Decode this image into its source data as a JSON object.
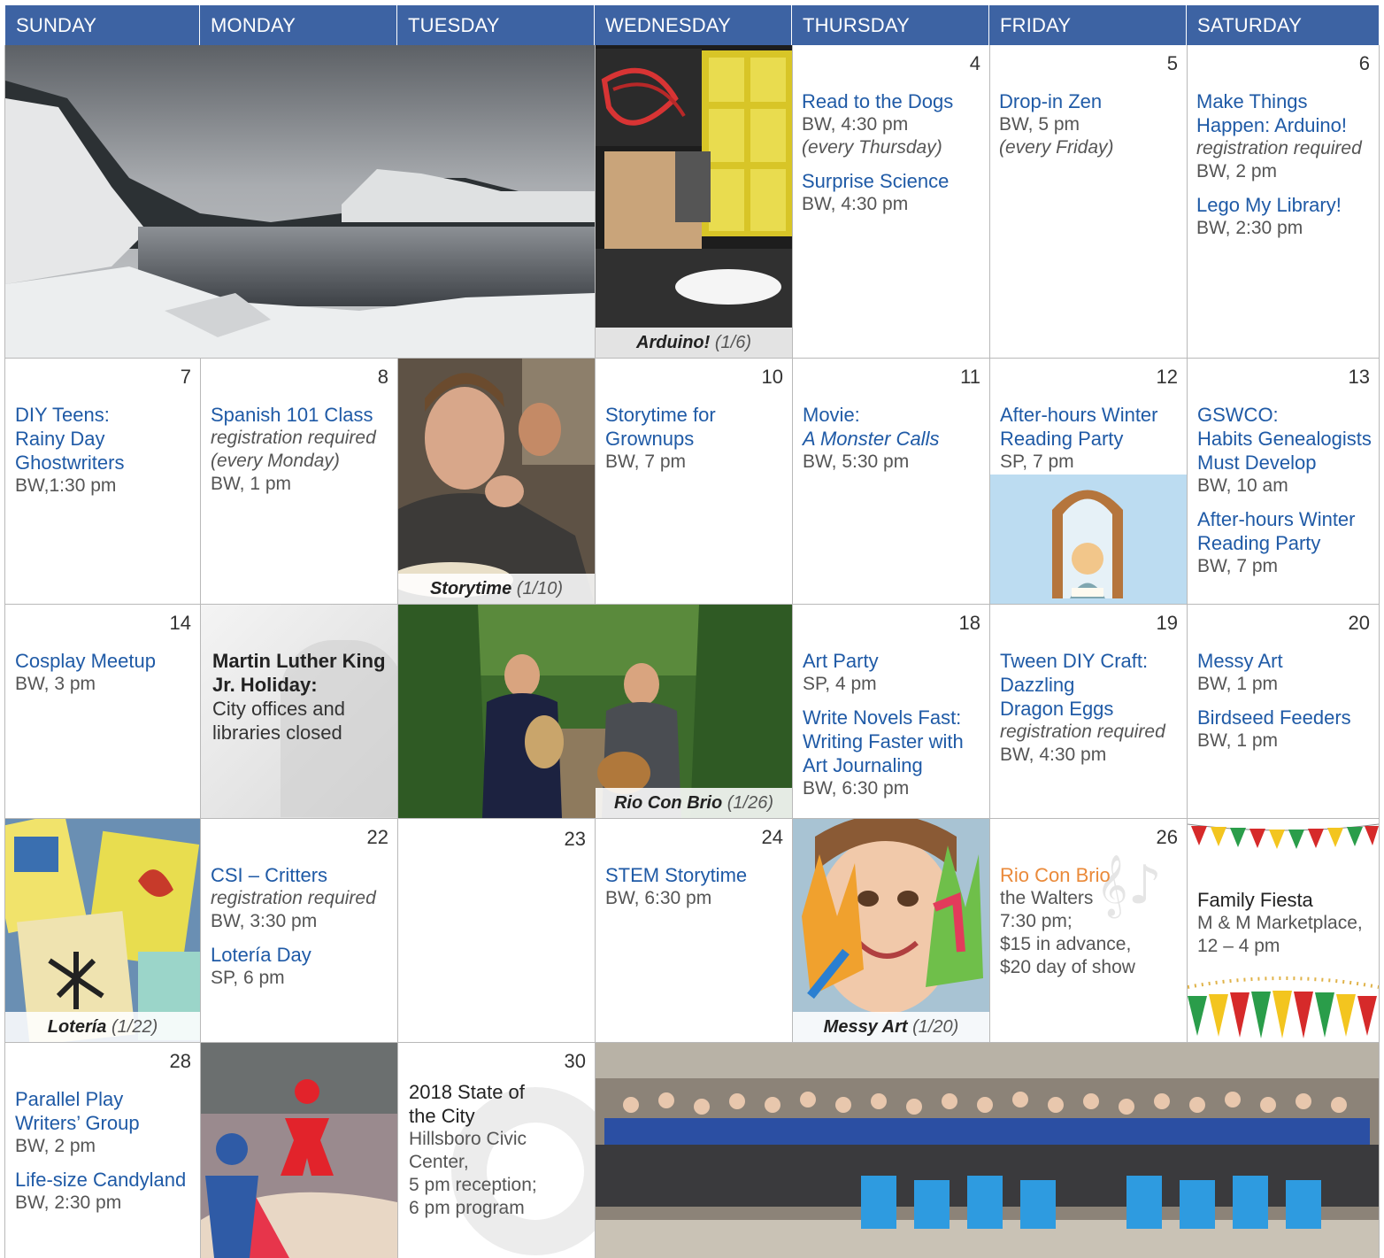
{
  "days": [
    "SUNDAY",
    "MONDAY",
    "TUESDAY",
    "WEDNESDAY",
    "THURSDAY",
    "FRIDAY",
    "SATURDAY"
  ],
  "week1": {
    "wed_caption_bold": "Arduino!",
    "wed_caption_date": "(1/6)",
    "thu": {
      "num": "4",
      "ev": [
        {
          "t": "Read to the Dogs",
          "d": "BW, 4:30 pm",
          "n": "(every Thursday)"
        },
        {
          "t": "Surprise Science",
          "d": "BW, 4:30 pm"
        }
      ]
    },
    "fri": {
      "num": "5",
      "ev": [
        {
          "t": "Drop-in Zen",
          "d": "BW, 5 pm",
          "n": "(every Friday)"
        }
      ]
    },
    "sat": {
      "num": "6",
      "ev": [
        {
          "t1": "Make Things",
          "t2": "Happen: Arduino!",
          "n": "registration required",
          "d": "BW, 2 pm"
        },
        {
          "t": "Lego My Library!",
          "d": "BW, 2:30 pm"
        }
      ]
    }
  },
  "week2": {
    "sun": {
      "num": "7",
      "t1": "DIY Teens:",
      "t2": "Rainy Day",
      "t3": "Ghostwriters",
      "d": "BW,1:30 pm"
    },
    "mon": {
      "num": "8",
      "t": "Spanish 101 Class",
      "n1": "registration required",
      "n2": "(every Monday)",
      "d": "BW, 1 pm"
    },
    "tue_caption_bold": "Storytime",
    "tue_caption_date": "(1/10)",
    "wed": {
      "num": "10",
      "t1": "Storytime for",
      "t2": "Grownups",
      "d": "BW, 7 pm"
    },
    "thu": {
      "num": "11",
      "t1": "Movie:",
      "t2": "A Monster Calls",
      "d": "BW, 5:30 pm"
    },
    "fri": {
      "num": "12",
      "t1": "After-hours Winter",
      "t2": "Reading Party",
      "d": "SP, 7 pm"
    },
    "sat": {
      "num": "13",
      "t1": "GSWCO:",
      "t2": "Habits Genealogists",
      "t3": "Must Develop",
      "d": "BW, 10 am",
      "e2t1": "After-hours Winter",
      "e2t2": "Reading Party",
      "e2d": "BW, 7 pm"
    }
  },
  "week3": {
    "sun": {
      "num": "14",
      "t": "Cosplay Meetup",
      "d": "BW, 3 pm"
    },
    "mon": {
      "t1": "Martin Luther King",
      "t2": "Jr. Holiday:",
      "d1": "City offices and",
      "d2": "libraries closed"
    },
    "tue_caption_bold": "Rio Con Brio",
    "tue_caption_date": "(1/26)",
    "thu": {
      "num": "18",
      "t": "Art Party",
      "d": "SP, 4 pm",
      "e2t1": "Write Novels Fast:",
      "e2t2": "Writing Faster with",
      "e2t3": "Art Journaling",
      "e2d": "BW, 6:30 pm"
    },
    "fri": {
      "num": "19",
      "t1": "Tween DIY Craft:",
      "t2": "Dazzling",
      "t3": "Dragon Eggs",
      "n": "registration required",
      "d": "BW, 4:30 pm"
    },
    "sat": {
      "num": "20",
      "t": "Messy Art",
      "d": "BW, 1 pm",
      "e2t": "Birdseed Feeders",
      "e2d": "BW, 1 pm"
    }
  },
  "week4": {
    "sun_caption_bold": "Lotería",
    "sun_caption_date": "(1/22)",
    "mon": {
      "num": "22",
      "t": "CSI – Critters",
      "n": "registration required",
      "d": "BW, 3:30 pm",
      "e2t": "Lotería Day",
      "e2d": "SP, 6 pm"
    },
    "tue": {
      "num": "23"
    },
    "wed": {
      "num": "24",
      "t": "STEM Storytime",
      "d": "BW, 6:30 pm"
    },
    "thu_caption_bold": "Messy Art",
    "thu_caption_date": "(1/20)",
    "fri": {
      "num": "26",
      "t": "Rio Con Brio",
      "d1": "the Walters",
      "d2": "7:30 pm;",
      "d3": "$15 in advance,",
      "d4": "$20 day of show"
    },
    "sat": {
      "t": "Family Fiesta",
      "d1": "M & M  Marketplace,",
      "d2": "12 – 4 pm"
    }
  },
  "week5": {
    "sun": {
      "num": "28",
      "t1": "Parallel Play",
      "t2": "Writers’ Group",
      "d": "BW, 2 pm",
      "e2t": "Life-size Candyland",
      "e2d": "BW, 2:30 pm"
    },
    "tue": {
      "num": "30",
      "t1": "2018 State of",
      "t2": "the City",
      "d1": "Hillsboro Civic",
      "d2": "Center,",
      "d3": "5 pm reception;",
      "d4": "6 pm program"
    }
  },
  "colors": {
    "header": "#3d63a3",
    "link": "#1f5aa6",
    "accent": "#ea8a3a"
  }
}
